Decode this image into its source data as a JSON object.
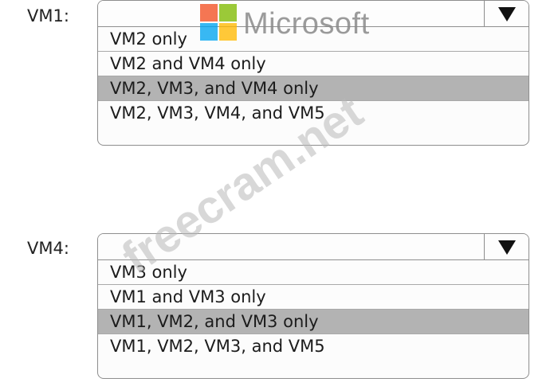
{
  "dropdowns": [
    {
      "label": "VM1:",
      "selected_value": "",
      "options": [
        {
          "label": "VM2 only",
          "selected": false
        },
        {
          "label": "VM2 and VM4 only",
          "selected": false
        },
        {
          "label": "VM2, VM3, and VM4 only",
          "selected": true
        },
        {
          "label": "VM2, VM3, VM4, and VM5",
          "selected": false
        }
      ]
    },
    {
      "label": "VM4:",
      "selected_value": "",
      "options": [
        {
          "label": "VM3 only",
          "selected": false
        },
        {
          "label": "VM1 and VM3 only",
          "selected": false
        },
        {
          "label": "VM1, VM2, and VM3 only",
          "selected": true
        },
        {
          "label": "VM1, VM2, VM3, and VM5",
          "selected": false
        }
      ]
    }
  ],
  "logo": {
    "text": "Microsoft",
    "colors": [
      "#f25022",
      "#7fba00",
      "#00a4ef",
      "#ffb900"
    ]
  },
  "watermark": {
    "text": "freecram.net"
  },
  "icons": {
    "dropdown_arrow": "triangle-down-icon"
  },
  "colors": {
    "selected_option_bg": "#b3b3b3",
    "border": "#8e8e8e"
  }
}
